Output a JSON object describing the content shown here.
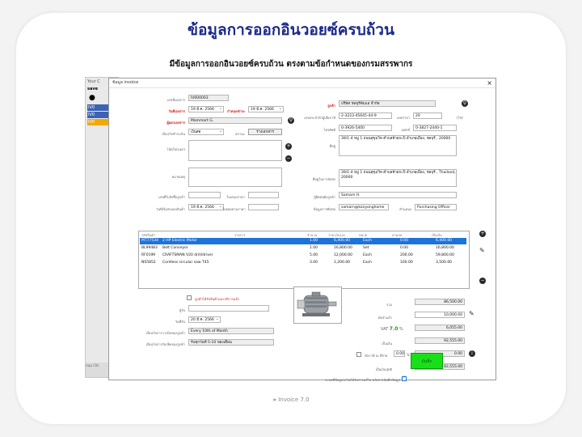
{
  "headline": "ข้อมูลการออกอินวอยซ์ครบถ้วน",
  "subline": "มีข้อมูลการออกอินวอยซ์ครบถ้วน ตรงตามข้อกำหนดของกรมสรรพากร",
  "footer": "Invoice 7.0",
  "background_app": {
    "title": "Your C",
    "save": "save",
    "rows": [
      "IV0",
      "IV0",
      "IV0"
    ],
    "bottom": "หนุ่ม Clik"
  },
  "dialog": {
    "title": "ข้อมูล invoice",
    "close": "×",
    "left": {
      "doc_no_label": "เลขที่เอกสาร",
      "doc_no": "IV000003",
      "doc_date_label": "วันที่เอกสาร",
      "doc_date": "19 มี.ค. 2566",
      "due_date_label": "กำหนดชำระ",
      "due_date": "19 มี.ค. 2566",
      "issuer_label": "ผู้ออกเอกสาร",
      "issuer": "Mammart G.",
      "payment_label": "เงื่อนไขชำระเงิน",
      "payment": "เงินสด",
      "status_label": "สถานะ",
      "status_btn": "ร่างเอกสาร",
      "note_label": "โน้ตใน(นอก)",
      "remark_label": "หมายเหตุ",
      "po_label": "เลขที่ใบสั่งซื้อลูกค้า",
      "po": "",
      "quote_label": "ใบเสนอราคา",
      "quote": "",
      "delivery_label": "วันที่เริ่มส่งมอบสินค้า",
      "delivery": "19 มี.ค. 2566",
      "ref_label": "ใบยอดตามราคา",
      "ref": ""
    },
    "right": {
      "customer_label": "ลูกค้า",
      "customer": "บริษัท ชลบุรีคัมแอ จำกัด",
      "taxid_label": "เลขประจำตัวผู้เสียภาษี",
      "taxid": "2-3223-45645-44-9",
      "branch_label": "เลขสาขา",
      "branch": "20",
      "branch_suffix": "(ไซ)",
      "phone_label": "โทรศัพท์",
      "phone": "0-3926-5400",
      "fax_label": "แฟกซ์",
      "fax": "0-3827-2440-1",
      "address_label": "ที่อยู่",
      "address": "39/1-4 หมู่ 1 ถนนสุขุมวิท ตำบลห้วยกะปิ อำเภอเมือง, ชลบุรี , 20000",
      "ship_label": "ที่อยู่ในการจัดส่ง",
      "ship": "39/1-4 หมู่ 1 ถนนสุขุมวิท ตำบลห้วยกะปิ อำเภอเมือง, ชลบุรี , Thailand, 20000",
      "contact_label": "ผู้ติดต่อฝั่งลูกค้า",
      "contact": "Samarn H.",
      "email_label": "ข้อมูลการติดต่อ",
      "email": "samarn@kanyonghome",
      "position_label": "ตำแหน่ง",
      "position": "Purchasing Officer"
    },
    "table": {
      "headers": [
        "รหัสสินค้า",
        "รายการ",
        "จำนวน",
        "ราคา/หน่วย",
        "หน่วย",
        "ส่วนลด",
        "เป็นเงิน"
      ],
      "rows": [
        [
          "MT77534",
          "2 HP Electric Motor",
          "1.00",
          "6,400.00",
          "Each",
          "0.00",
          "6,400.00"
        ],
        [
          "BL99483",
          "Belt Conveyor",
          "1.00",
          "16,800.00",
          "Set",
          "0.00",
          "16,800.00"
        ],
        [
          "RF0199",
          "CRAFTSMAN V20 drill/driver",
          "5.00",
          "12,000.00",
          "Each",
          "200.00",
          "59,800.00"
        ],
        [
          "NS5852",
          "Cordless circular saw T45",
          "3.00",
          "1,200.00",
          "Each",
          "100.00",
          "3,500.00"
        ]
      ]
    },
    "bottom": {
      "received_check": "ลูกค้าได้รับสินค้าและบริการแล้ว",
      "receiver_label": "ผู้รับ",
      "receiver": "",
      "recv_date_label": "วันที่รับ",
      "recv_date": "20 มี.ค. 2566",
      "bill_cond_label": "เงื่อนไขการวางบิลของลูกค้า",
      "bill_cond": "Every 10th of Month",
      "pay_cond_label": "เงื่อนไขการรับเช็คของลูกค้า",
      "pay_cond": "รับทุกวันที่ 5-10 ของเดือน",
      "sum_label": "รวม",
      "sum": "86,500.00",
      "deposit_label": "มัดจำแล้ว",
      "deposit": "10,000.00",
      "vat_label": "VAT",
      "vat_rate": "7.0",
      "vat_pct": "%",
      "vat": "6,055.00",
      "net_label": "เป็นเงิน",
      "net": "92,555.00",
      "wht_label": "หักภาษี ณ ที่จ่าย",
      "wht_rate": "0.00",
      "wht_pct": "%",
      "wht": "0.00",
      "grand_label": "เป็นเงินสุทธิ",
      "grand": "82,555.00",
      "confirm_label": "ระบบที่ข้อมูลจะไม่ได้รับการแก้ไข หลังการบันทึกข้อมูล",
      "save_btn": "บันทึก"
    }
  }
}
